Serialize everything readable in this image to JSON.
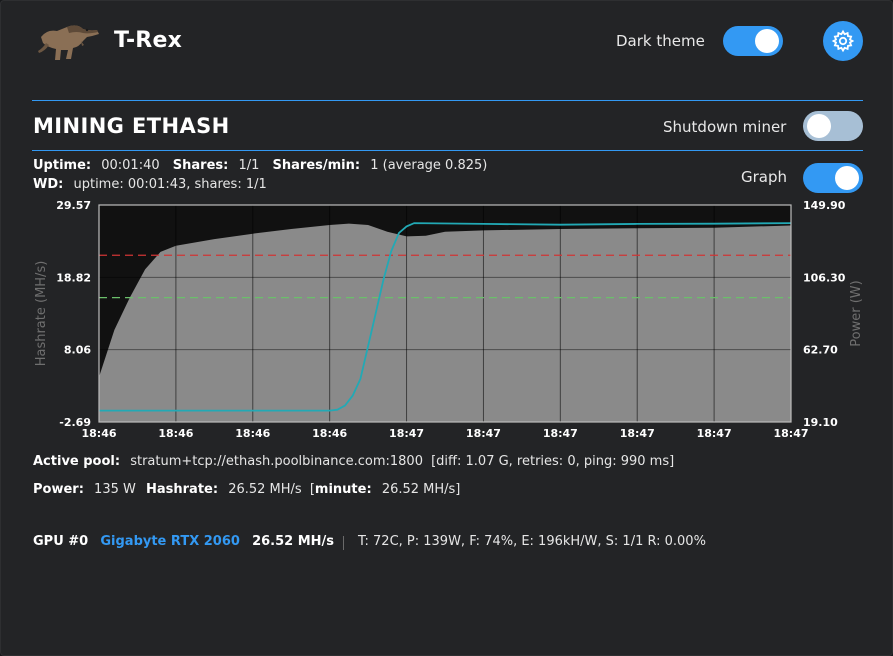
{
  "header": {
    "title": "T-Rex",
    "dark_theme_label": "Dark theme",
    "dark_theme_on": true
  },
  "section": {
    "title": "MINING ETHASH",
    "shutdown_label": "Shutdown miner",
    "shutdown_on": false,
    "graph_label": "Graph",
    "graph_on": true
  },
  "stats": {
    "uptime_label": "Uptime:",
    "uptime": "00:01:40",
    "shares_label": "Shares:",
    "shares": "1/1",
    "shares_min_label": "Shares/min:",
    "shares_min": "1 (average 0.825)",
    "wd_label": "WD:",
    "wd": "uptime: 00:01:43, shares: 1/1"
  },
  "chart_data": {
    "type": "area",
    "y_left_label": "Hashrate (MH/s)",
    "y_right_label": "Power (W)",
    "y_left_ticks": [
      "29.57",
      "18.82",
      "8.06",
      "-2.69"
    ],
    "y_right_ticks": [
      "149.90",
      "106.30",
      "62.70",
      "19.10"
    ],
    "ylim_left": [
      -2.69,
      29.57
    ],
    "ylim_right": [
      19.1,
      149.9
    ],
    "x_ticks": [
      "18:46",
      "18:46",
      "18:46",
      "18:46",
      "18:47",
      "18:47",
      "18:47",
      "18:47",
      "18:47",
      "18:47"
    ],
    "grid": true,
    "series": [
      {
        "values": [
          [
            0,
            4.0
          ],
          [
            0.2,
            11.0
          ],
          [
            0.4,
            15.8
          ],
          [
            0.6,
            20.0
          ],
          [
            0.8,
            22.6
          ],
          [
            1.0,
            23.5
          ],
          [
            1.5,
            24.5
          ],
          [
            2.0,
            25.3
          ],
          [
            2.5,
            26.0
          ],
          [
            3.0,
            26.6
          ],
          [
            3.25,
            26.8
          ],
          [
            3.5,
            26.6
          ],
          [
            3.75,
            25.6
          ],
          [
            4.0,
            24.9
          ],
          [
            4.25,
            25.0
          ],
          [
            4.5,
            25.6
          ],
          [
            5.0,
            25.8
          ],
          [
            6.0,
            26.0
          ],
          [
            7.0,
            26.1
          ],
          [
            8.0,
            26.2
          ],
          [
            9.0,
            26.52
          ]
        ],
        "color": "#8a8a8a"
      },
      {
        "values": [
          [
            0,
            26.0
          ],
          [
            1.0,
            26.0
          ],
          [
            2.0,
            26.0
          ],
          [
            3.0,
            26.0
          ],
          [
            3.1,
            26.5
          ],
          [
            3.2,
            29.0
          ],
          [
            3.3,
            35.0
          ],
          [
            3.4,
            45.0
          ],
          [
            3.55,
            75.0
          ],
          [
            3.7,
            105.0
          ],
          [
            3.8,
            122.0
          ],
          [
            3.9,
            133.0
          ],
          [
            4.0,
            137.0
          ],
          [
            4.1,
            139.0
          ],
          [
            5.0,
            138.5
          ],
          [
            6.0,
            138.0
          ],
          [
            7.0,
            138.5
          ],
          [
            8.0,
            138.6
          ],
          [
            9.0,
            139.0
          ]
        ],
        "color": "#22a9b5"
      }
    ],
    "reference_lines": [
      {
        "value": 22.1,
        "color": "#d03535"
      },
      {
        "value": 15.8,
        "color": "#6bbf6b"
      }
    ]
  },
  "pool": {
    "label": "Active pool:",
    "value": "stratum+tcp://ethash.poolbinance.com:1800",
    "details": "[diff: 1.07 G, retries: 0, ping: 990 ms]"
  },
  "power_line": {
    "power_label": "Power:",
    "power": "135 W",
    "hashrate_label": "Hashrate:",
    "hashrate": "26.52 MH/s",
    "minute_open": "[",
    "minute_label": "minute:",
    "minute": "26.52 MH/s]"
  },
  "gpu": {
    "id": "GPU #0",
    "model": "Gigabyte RTX 2060",
    "hashrate": "26.52 MH/s",
    "details": "T: 72C, P: 139W, F: 74%, E: 196kH/W, S: 1/1 R: 0.00%"
  },
  "colors": {
    "accent": "#3399f3",
    "background": "#232426",
    "area_fill": "#8a8a8a",
    "power_line": "#22a9b5"
  }
}
